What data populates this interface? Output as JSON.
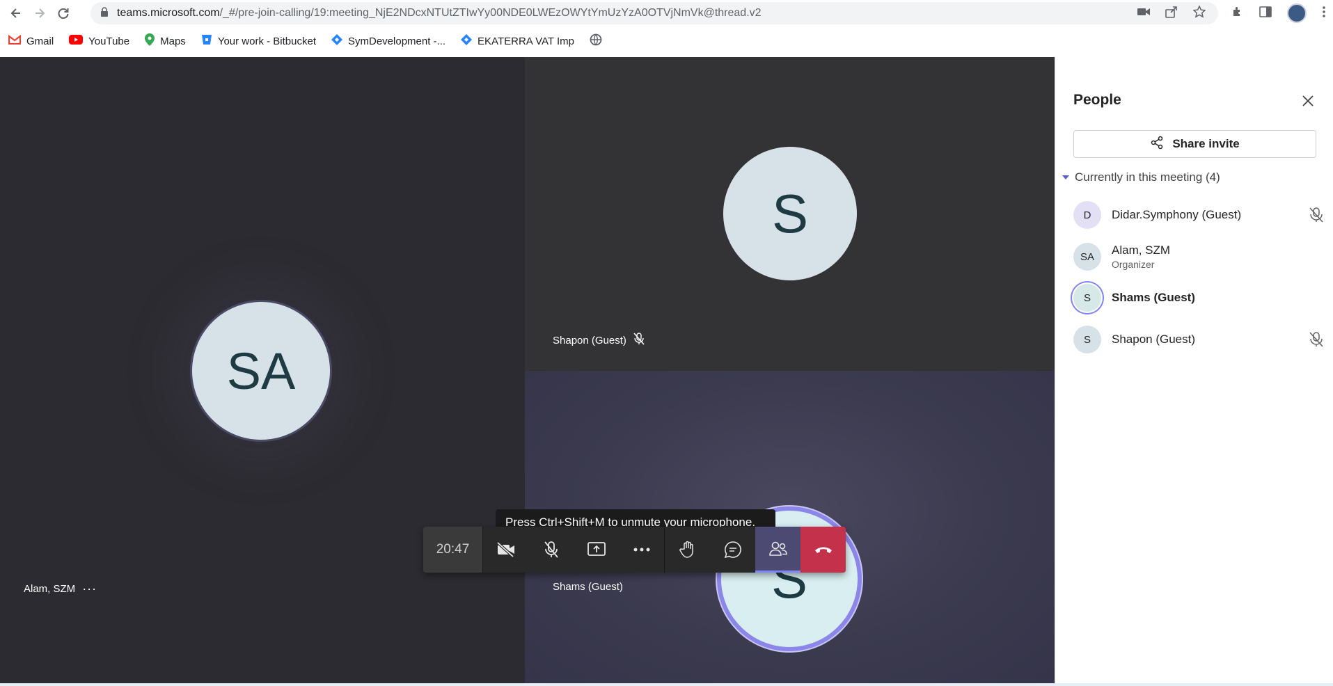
{
  "browser": {
    "url_host": "teams.microsoft.com",
    "url_path": "/_#/pre-join-calling/19:meeting_NjE2NDcxNTUtZTIwYy00NDE0LWEzOWYtYmUzYzA0OTVjNmVk@thread.v2",
    "bookmarks": [
      {
        "label": "Gmail",
        "icon": "gmail-icon",
        "color": "#ea4335"
      },
      {
        "label": "YouTube",
        "icon": "youtube-icon",
        "color": "#ff0000"
      },
      {
        "label": "Maps",
        "icon": "maps-icon",
        "color": "#34a853"
      },
      {
        "label": "Your work - Bitbucket",
        "icon": "bitbucket-icon",
        "color": "#2684ff"
      },
      {
        "label": "SymDevelopment -...",
        "icon": "jira-icon",
        "color": "#2684ff"
      },
      {
        "label": "EKATERRA VAT Imp",
        "icon": "jira-icon",
        "color": "#2684ff"
      }
    ]
  },
  "stage": {
    "left_tile": {
      "initials": "SA",
      "name": "Alam, SZM"
    },
    "top_right_tile": {
      "initials": "S",
      "name": "Shapon (Guest)"
    },
    "bottom_right_tile": {
      "initials": "S",
      "name": "Shams (Guest)"
    },
    "tooltip": "Press Ctrl+Shift+M to unmute your microphone.",
    "timer": "20:47"
  },
  "panel": {
    "title": "People",
    "share_label": "Share invite",
    "section_label": "Currently in this meeting (4)",
    "participants": [
      {
        "initials": "D",
        "name": "Didar.Symphony (Guest)",
        "role": "",
        "muted": true,
        "avatar_color": "#e3e0f5"
      },
      {
        "initials": "SA",
        "name": "Alam, SZM",
        "role": "Organizer",
        "muted": false,
        "avatar_color": "#d6e2e8"
      },
      {
        "initials": "S",
        "name": "Shams (Guest)",
        "role": "",
        "muted": false,
        "avatar_color": "#d6e8e8"
      },
      {
        "initials": "S",
        "name": "Shapon (Guest)",
        "role": "",
        "muted": true,
        "avatar_color": "#d6e2e8"
      }
    ]
  },
  "colors": {
    "accent": "#7f85f5",
    "hangup": "#c4314b"
  }
}
